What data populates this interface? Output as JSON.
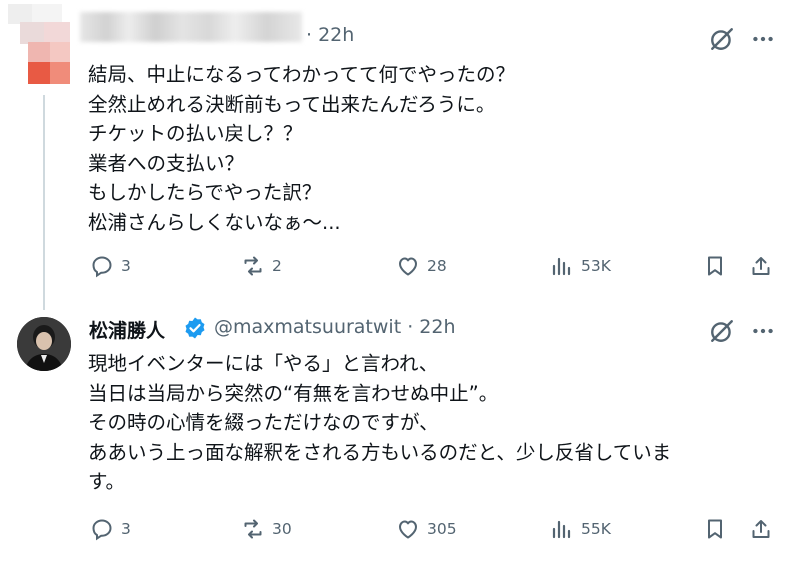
{
  "tweet1": {
    "time": "· 22h",
    "body": "結局、中止になるってわかってて何でやったの？\n全然止めれる決断前もって出来たんだろうに。\nチケットの払い戻し？？\n業者への支払い？\nもしかしたらでやった訳？\n松浦さんらしくないなぁ〜...",
    "actions": {
      "replies": "3",
      "reposts": "2",
      "likes": "28",
      "views": "53K"
    }
  },
  "tweet2": {
    "display_name": "松浦勝人",
    "handle_time": "@maxmatsuuratwit · 22h",
    "body": "現地イベンターには「やる」と言われ、\n当日は当局から突然の“有無を言わせぬ中止”。\nその時の心情を綴っただけなのですが、\nああいう上っ面な解釈をされる方もいるのだと、少し反省していま\nす。",
    "actions": {
      "replies": "3",
      "reposts": "30",
      "likes": "305",
      "views": "55K"
    }
  },
  "colors": {
    "text": "#0f1419",
    "secondary": "#536471",
    "verified": "#1d9bf0",
    "line": "#cfd9de"
  },
  "icons": [
    "grok-icon",
    "more-icon",
    "reply-icon",
    "repost-icon",
    "like-icon",
    "views-icon",
    "bookmark-icon",
    "share-icon",
    "verified-badge-icon"
  ]
}
